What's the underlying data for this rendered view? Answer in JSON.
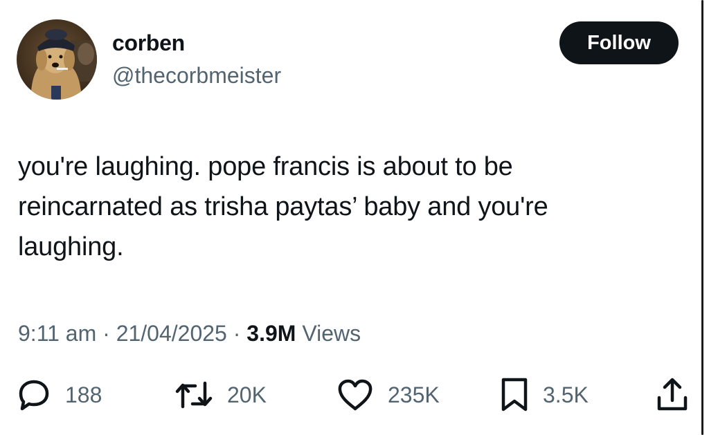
{
  "author": {
    "name": "corben",
    "handle": "@thecorbmeister",
    "avatar_icon": "dog-avatar-icon"
  },
  "follow_button": {
    "label": "Follow",
    "background": "#0f1419",
    "text_color": "#ffffff"
  },
  "tweet": {
    "lines": [
      "you're laughing. pope francis is about to be",
      "reincarnated as trisha paytas’ baby and you're",
      "laughing."
    ]
  },
  "meta": {
    "time": "9:11 am",
    "separator": "·",
    "date": "21/04/2025",
    "views_count": "3.9M",
    "views_label": "Views"
  },
  "actions": {
    "replies": {
      "icon": "reply-icon",
      "count": "188"
    },
    "reposts": {
      "icon": "repost-icon",
      "count": "20K"
    },
    "likes": {
      "icon": "heart-icon",
      "count": "235K"
    },
    "bookmarks": {
      "icon": "bookmark-icon",
      "count": "3.5K"
    },
    "share": {
      "icon": "share-icon"
    }
  },
  "colors": {
    "text_primary": "#0f1419",
    "text_secondary": "#536471",
    "background": "#ffffff"
  }
}
